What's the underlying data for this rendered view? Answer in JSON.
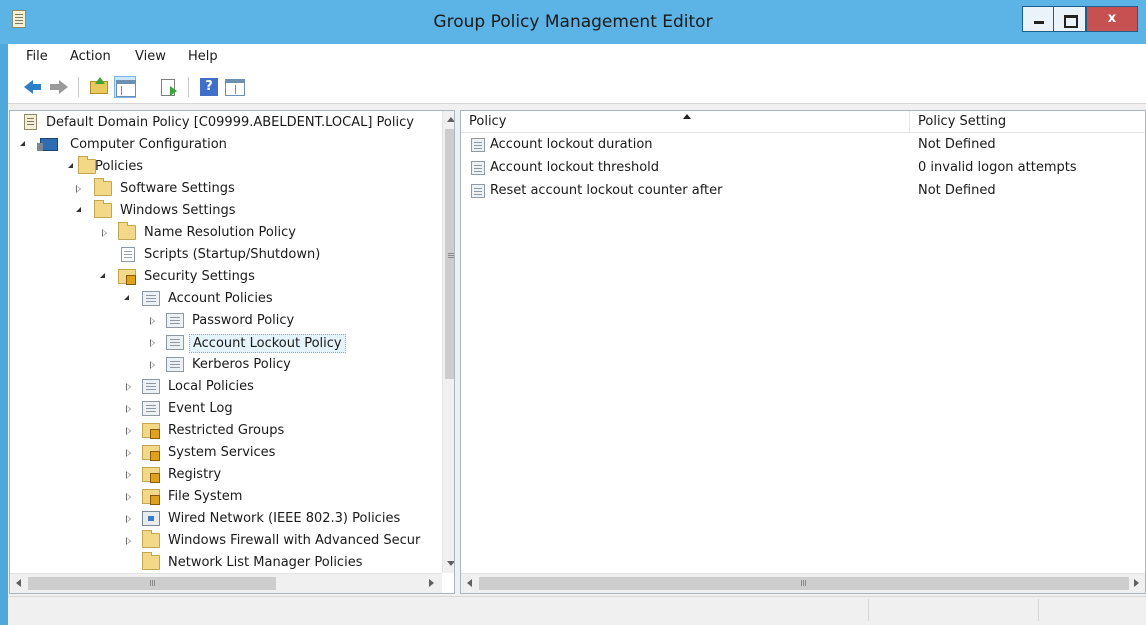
{
  "window": {
    "title": "Group Policy Management Editor",
    "close_glyph": "x",
    "accent_color": "#5cb3e6"
  },
  "menu": {
    "items": [
      "File",
      "Action",
      "View",
      "Help"
    ]
  },
  "toolbar": {
    "icons": [
      "back-arrow-icon",
      "forward-arrow-icon",
      "up-one-level-icon",
      "show-hide-console-tree-icon",
      "export-list-icon",
      "help-icon",
      "show-hide-action-pane-icon"
    ],
    "help_glyph": "?"
  },
  "tree": {
    "root": "Default Domain Policy [C09999.ABELDENT.LOCAL] Policy",
    "computer_configuration": "Computer Configuration",
    "policies": "Policies",
    "software_settings": "Software Settings",
    "windows_settings": "Windows Settings",
    "name_resolution_policy": "Name Resolution Policy",
    "scripts": "Scripts (Startup/Shutdown)",
    "security_settings": "Security Settings",
    "account_policies": "Account Policies",
    "password_policy": "Password Policy",
    "account_lockout_policy": "Account Lockout Policy",
    "kerberos_policy": "Kerberos Policy",
    "local_policies": "Local Policies",
    "event_log": "Event Log",
    "restricted_groups": "Restricted Groups",
    "system_services": "System Services",
    "registry": "Registry",
    "file_system": "File System",
    "wired_network": "Wired Network (IEEE 802.3) Policies",
    "windows_firewall": "Windows Firewall with Advanced Secur",
    "network_list_manager": "Network List Manager Policies",
    "selected": "Account Lockout Policy"
  },
  "list": {
    "columns": [
      "Policy",
      "Policy Setting"
    ],
    "rows": [
      {
        "policy": "Account lockout duration",
        "setting": "Not Defined"
      },
      {
        "policy": "Account lockout threshold",
        "setting": "0 invalid logon attempts"
      },
      {
        "policy": "Reset account lockout counter after",
        "setting": "Not Defined"
      }
    ]
  },
  "scroll_glyph": "III"
}
